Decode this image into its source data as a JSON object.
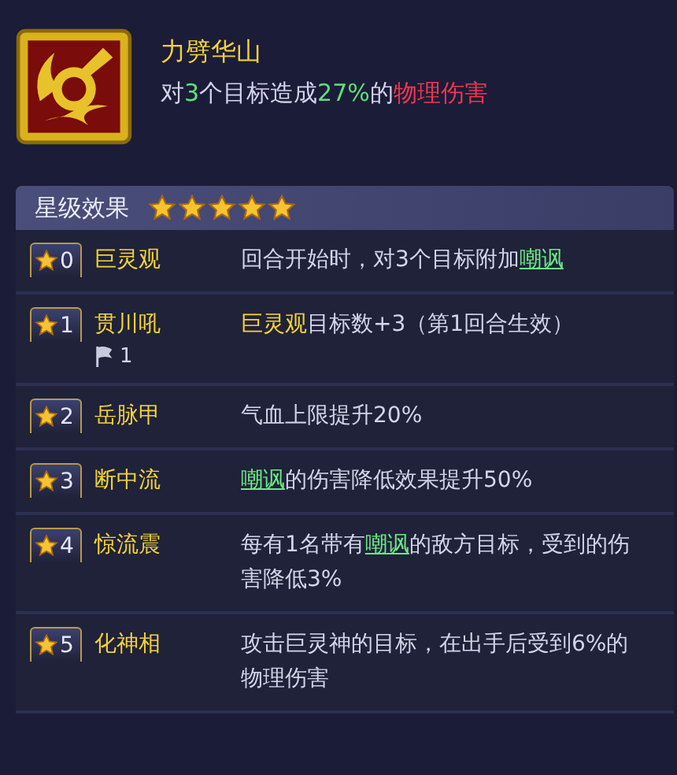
{
  "skill": {
    "name": "力劈华山",
    "description": [
      {
        "text": "对",
        "kind": "plain"
      },
      {
        "text": "3",
        "kind": "green"
      },
      {
        "text": "个目标造成",
        "kind": "plain"
      },
      {
        "text": "27%",
        "kind": "green"
      },
      {
        "text": "的",
        "kind": "plain"
      },
      {
        "text": "物理伤害",
        "kind": "red"
      }
    ]
  },
  "star_effects": {
    "title": "星级效果",
    "stars": 5,
    "rows": [
      {
        "level": "0",
        "name": "巨灵观",
        "description": [
          {
            "text": "回合开始时，对3个目标附加",
            "kind": "plain"
          },
          {
            "text": "嘲讽",
            "kind": "link"
          }
        ]
      },
      {
        "level": "1",
        "name": "贯川吼",
        "flag_count": "1",
        "description": [
          {
            "text": "巨灵观",
            "kind": "highlight"
          },
          {
            "text": "目标数+3（第1回合生效）",
            "kind": "plain"
          }
        ]
      },
      {
        "level": "2",
        "name": "岳脉甲",
        "description": [
          {
            "text": "气血上限提升20%",
            "kind": "plain"
          }
        ]
      },
      {
        "level": "3",
        "name": "断中流",
        "description": [
          {
            "text": "嘲讽",
            "kind": "link"
          },
          {
            "text": "的伤害降低效果提升50%",
            "kind": "plain"
          }
        ]
      },
      {
        "level": "4",
        "name": "惊流震",
        "description": [
          {
            "text": "每有1名带有",
            "kind": "plain"
          },
          {
            "text": "嘲讽",
            "kind": "link"
          },
          {
            "text": "的敌方目标，受到的伤害降低3%",
            "kind": "plain"
          }
        ]
      },
      {
        "level": "5",
        "name": "化神相",
        "description": [
          {
            "text": "攻击巨灵神的目标，在出手后受到6%的物理伤害",
            "kind": "plain"
          }
        ]
      }
    ]
  }
}
